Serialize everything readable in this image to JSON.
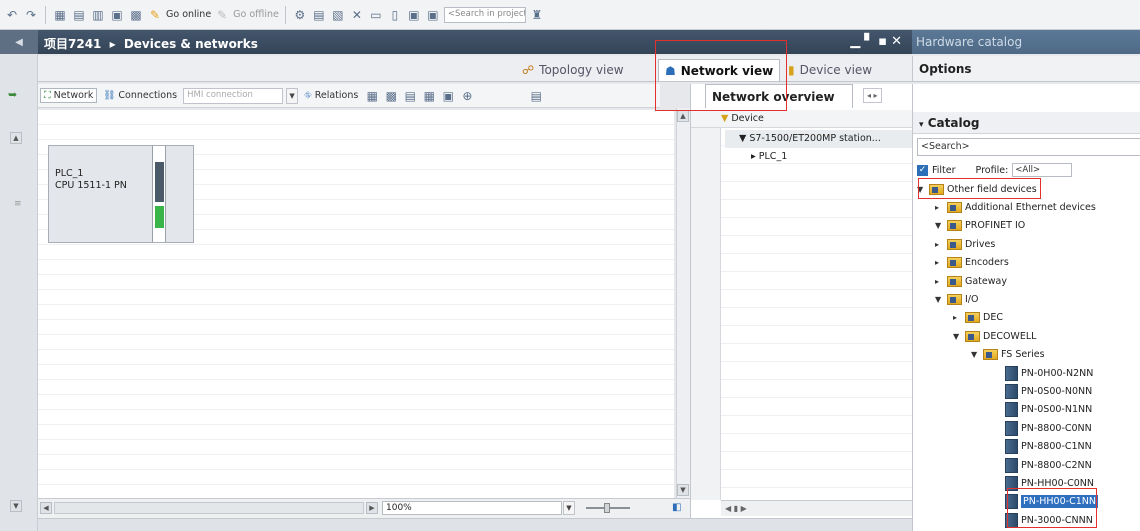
{
  "toolbar": {
    "go_online": "Go online",
    "go_offline": "Go offline",
    "search_placeholder": "<Search in project>"
  },
  "title_bar": {
    "breadcrumb_project": "项目7241",
    "breadcrumb_sep": "▸",
    "breadcrumb_page": "Devices & networks"
  },
  "hardware_catalog_title": "Hardware catalog",
  "view_tabs": {
    "topology": "Topology view",
    "network": "Network view",
    "device": "Device view"
  },
  "options_label": "Options",
  "network_toolbar": {
    "network": "Network",
    "connections": "Connections",
    "hmi_connection": "HMI connection",
    "relations": "Relations"
  },
  "plc": {
    "name": "PLC_1",
    "cpu": "CPU 1511-1 PN"
  },
  "zoom": {
    "value": "100%"
  },
  "network_overview": {
    "tab_label": "Network overview",
    "column_device": "Device",
    "rows": [
      "▼ S7-1500/ET200MP station...",
      "▸ PLC_1"
    ]
  },
  "catalog": {
    "header": "Catalog",
    "search_placeholder": "<Search>",
    "filter_label": "Filter",
    "profile_label": "Profile:",
    "profile_value": "<All>",
    "tree": [
      {
        "label": "Other field devices",
        "level": 0,
        "type": "folder",
        "expanded": true
      },
      {
        "label": "Additional Ethernet devices",
        "level": 1,
        "type": "folder",
        "expanded": false
      },
      {
        "label": "PROFINET IO",
        "level": 1,
        "type": "folder",
        "expanded": true
      },
      {
        "label": "Drives",
        "level": 2,
        "type": "folder",
        "expanded": false
      },
      {
        "label": "Encoders",
        "level": 2,
        "type": "folder",
        "expanded": false
      },
      {
        "label": "Gateway",
        "level": 2,
        "type": "folder",
        "expanded": false
      },
      {
        "label": "I/O",
        "level": 2,
        "type": "folder",
        "expanded": true
      },
      {
        "label": "DEC",
        "level": 3,
        "type": "folder",
        "expanded": false
      },
      {
        "label": "DECOWELL",
        "level": 3,
        "type": "folder",
        "expanded": true
      },
      {
        "label": "FS Series",
        "level": 4,
        "type": "folder",
        "expanded": true
      },
      {
        "label": "PN-0H00-N2NN",
        "level": 5,
        "type": "device"
      },
      {
        "label": "PN-0S00-N0NN",
        "level": 5,
        "type": "device"
      },
      {
        "label": "PN-0S00-N1NN",
        "level": 5,
        "type": "device"
      },
      {
        "label": "PN-8800-C0NN",
        "level": 5,
        "type": "device"
      },
      {
        "label": "PN-8800-C1NN",
        "level": 5,
        "type": "device"
      },
      {
        "label": "PN-8800-C2NN",
        "level": 5,
        "type": "device"
      },
      {
        "label": "PN-HH00-C0NN",
        "level": 5,
        "type": "device"
      },
      {
        "label": "PN-HH00-C1NN",
        "level": 5,
        "type": "device",
        "selected": true
      },
      {
        "label": "PN-3000-CNNN",
        "level": 5,
        "type": "device"
      }
    ]
  },
  "colors": {
    "title_bar": "#3b4d62",
    "accent_blue": "#2e6fbf",
    "highlight_red": "#e2302c",
    "plc_led": "#39b54a"
  }
}
